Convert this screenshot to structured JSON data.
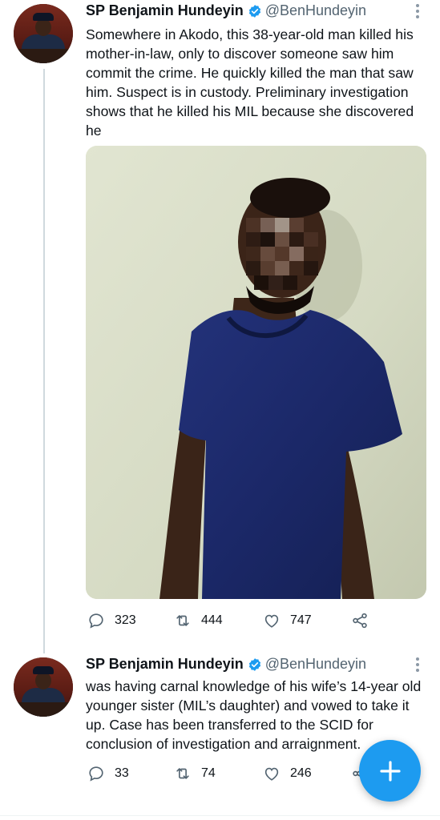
{
  "tweets": [
    {
      "author_name": "SP Benjamin Hundeyin",
      "handle": "@BenHundeyin",
      "text": "Somewhere in Akodo, this 38-year-old man killed his mother-in-law, only to discover someone saw him commit the crime. He quickly killed the man that saw him. Suspect is in custody. Preliminary investigation shows that he killed his MIL because she discovered he",
      "replies": "323",
      "retweets": "444",
      "likes": "747"
    },
    {
      "author_name": "SP Benjamin Hundeyin",
      "handle": "@BenHundeyin",
      "text": "was having carnal knowledge of his wife’s 14-year old younger sister (MIL’s daughter) and vowed to take it up. Case has been transferred to the SCID for conclusion of investigation and arraignment.",
      "replies": "33",
      "retweets": "74",
      "likes": "246"
    }
  ],
  "colors": {
    "accent": "#1d9bf0",
    "secondary_text": "#536471",
    "primary_text": "#0f1419"
  },
  "icons": [
    "verified-badge-icon",
    "more-options-icon",
    "reply-icon",
    "retweet-icon",
    "like-icon",
    "share-icon",
    "compose-plus-icon"
  ]
}
